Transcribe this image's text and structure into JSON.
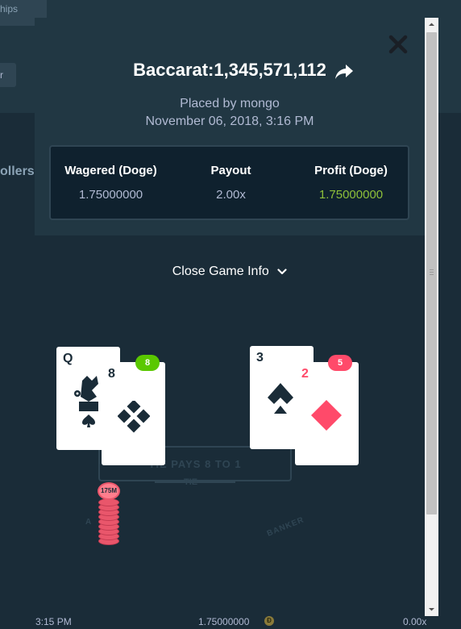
{
  "background": {
    "banner_text": "hips",
    "pill_text": "r",
    "tab_text": "ollers",
    "footer": {
      "time": "3:15 PM",
      "amount": "1.75000000",
      "coin_symbol": "Ð",
      "payout": "0.00x"
    }
  },
  "modal": {
    "close_icon": "close-icon",
    "title": "Baccarat:1,345,571,112",
    "share_icon": "share-arrow-icon",
    "placed_by": "Placed by mongo",
    "date": "November 06, 2018, 3:16 PM",
    "stats": {
      "wagered_label": "Wagered (Doge)",
      "wagered_value": "1.75000000",
      "payout_label": "Payout",
      "payout_value": "2.00x",
      "profit_label": "Profit (Doge)",
      "profit_value": "1.75000000"
    },
    "toggle_label": "Close Game Info",
    "toggle_icon": "chevron-down-icon"
  },
  "game": {
    "player": {
      "score": "8",
      "cards": [
        {
          "rank": "Q",
          "suit": "spades"
        },
        {
          "rank": "8",
          "suit": "clubs"
        }
      ]
    },
    "banker": {
      "score": "5",
      "cards": [
        {
          "rank": "3",
          "suit": "spades"
        },
        {
          "rank": "2",
          "suit": "diamonds"
        }
      ]
    },
    "table_text": "TIE PAYS 8 TO 1",
    "tie_label": "TIE",
    "banker_label": "BANKER",
    "player_label": "A",
    "chip_label": "175M"
  },
  "colors": {
    "profit_green": "#8ec03a",
    "player_badge": "#5ac800",
    "banker_badge": "#ff4a6a",
    "card_red": "#ff4a6a",
    "chip": "#e9566b"
  }
}
